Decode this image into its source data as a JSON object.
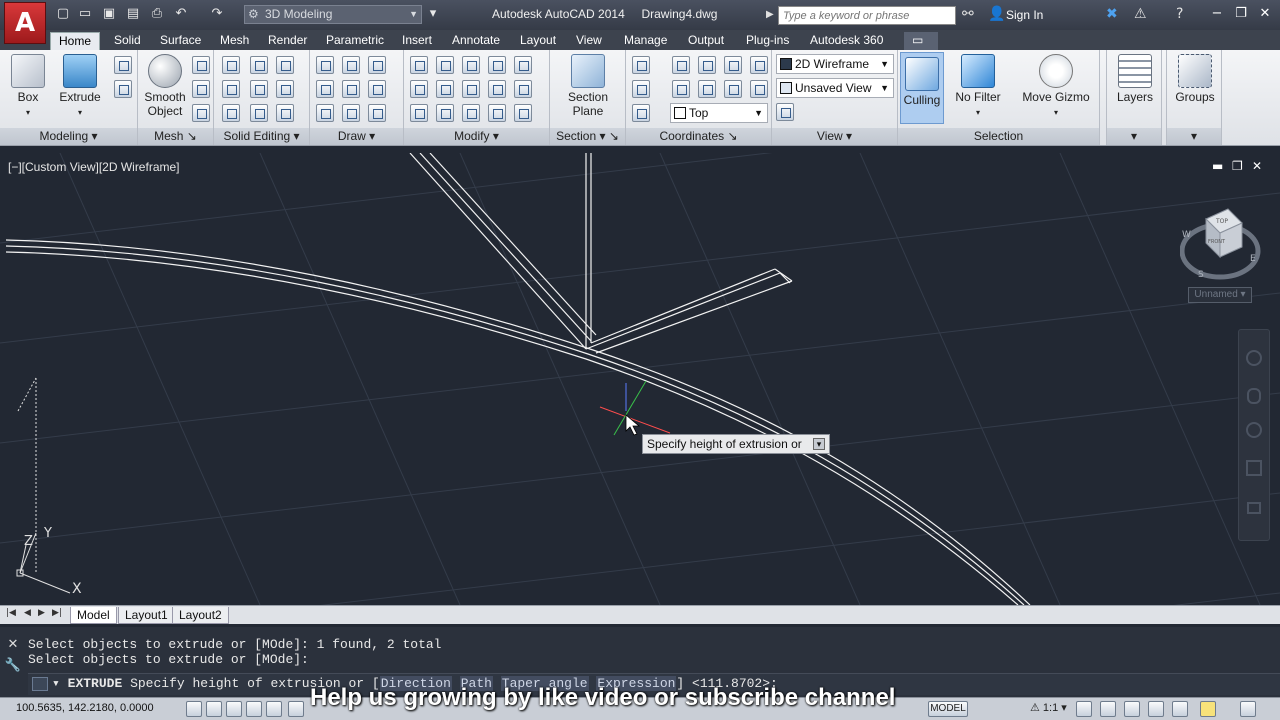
{
  "titlebar": {
    "app_name": "Autodesk AutoCAD 2014",
    "drawing_name": "Drawing4.dwg",
    "workspace": "3D Modeling",
    "search_placeholder": "Type a keyword or phrase",
    "signin": "Sign In"
  },
  "ribbon_tabs": [
    "Home",
    "Solid",
    "Surface",
    "Mesh",
    "Render",
    "Parametric",
    "Insert",
    "Annotate",
    "Layout",
    "View",
    "Manage",
    "Output",
    "Plug-ins",
    "Autodesk 360"
  ],
  "panels": {
    "modeling": {
      "title": "Modeling",
      "box": "Box",
      "extrude": "Extrude"
    },
    "mesh": {
      "title": "Mesh",
      "smooth_object_1": "Smooth",
      "smooth_object_2": "Object"
    },
    "solid_editing": {
      "title": "Solid Editing"
    },
    "draw": {
      "title": "Draw"
    },
    "modify": {
      "title": "Modify"
    },
    "section": {
      "title": "Section",
      "plane_1": "Section",
      "plane_2": "Plane"
    },
    "coordinates": {
      "title": "Coordinates",
      "view_combo": "Top"
    },
    "view": {
      "title": "View",
      "visual_style": "2D Wireframe",
      "saved_view": "Unsaved View"
    },
    "selection": {
      "title": "Selection",
      "culling": "Culling",
      "no_filter": "No Filter",
      "move_gizmo": "Move Gizmo"
    },
    "layers": {
      "label": "Layers"
    },
    "groups": {
      "label": "Groups"
    }
  },
  "viewport": {
    "label": "[−][Custom View][2D Wireframe]",
    "viewcube_top": "TOP",
    "viewcube_front": "FRONT",
    "compass_w": "W",
    "compass_s": "S",
    "compass_e": "E",
    "named_view": "Unnamed",
    "tooltip": "Specify height of extrusion or",
    "ucs_x": "X",
    "ucs_y": "Y",
    "ucs_z": "Z"
  },
  "layout_tabs": [
    "Model",
    "Layout1",
    "Layout2"
  ],
  "command": {
    "history_1": "Select objects to extrude or [MOde]: 1 found, 2 total",
    "history_2": "Select objects to extrude or [MOde]:",
    "name": "EXTRUDE",
    "prompt": "Specify height of extrusion or [",
    "options": [
      "Direction",
      "Path",
      "Taper angle",
      "Expression"
    ],
    "default": "] <111.8702>:"
  },
  "statusbar": {
    "coords": "100.5635, 142.2180, 0.0000",
    "model": "MODEL",
    "scale": "1:1"
  },
  "overlay": "Help us growing by like video or subscribe channel"
}
